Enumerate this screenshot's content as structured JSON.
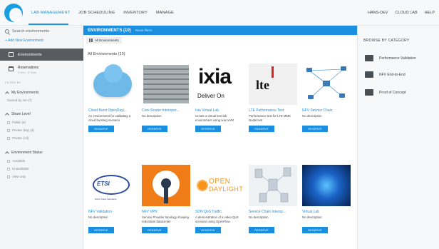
{
  "topnav": {
    "items": [
      {
        "label": "LAB MANAGEMENT",
        "active": true
      },
      {
        "label": "JOB SCHEDULING",
        "active": false
      },
      {
        "label": "INVENTORY",
        "active": false
      },
      {
        "label": "MANAGE",
        "active": false
      }
    ],
    "right": [
      "HANS-DEV",
      "CLOUD LAB",
      "HELP"
    ]
  },
  "sidebar": {
    "search_placeholder": "Search environments",
    "add_environment": "+ Add New Environment",
    "environments_label": "Environments",
    "reservations_label": "Reservations",
    "reservations_sub": "3 Nex · 5 Total",
    "filter_by": "FILTER BY",
    "my_envs": {
      "title": "My Environments",
      "options": [
        "Owned by me (7)"
      ]
    },
    "share_level": {
      "title": "Share Level",
      "options": [
        "Public (6)",
        "Private (My) (4)",
        "Private (All)"
      ]
    },
    "env_status": {
      "title": "Environment Status",
      "options": [
        "Available",
        "Unavailable",
        "View only"
      ]
    }
  },
  "header": {
    "title": "ENVIRONMENTS (10)",
    "reset": "Reset filters",
    "toggle_label": "All Environments",
    "section_heading": "All Environments (10)"
  },
  "right_panel": {
    "title": "BROWSE BY CATEGORY",
    "categories": [
      "Performance Validation",
      "NFV End-to-End",
      "Proof of Concept"
    ]
  },
  "reserve_label": "RESERVE",
  "cards": [
    {
      "name": "Cloud Burst OpenDayl...",
      "desc": "An environment for validating a cloud bursting scenario",
      "thumb": "cloud"
    },
    {
      "name": "Core Router Interoper...",
      "desc": "No description",
      "thumb": "router"
    },
    {
      "name": "Ixia Virtual Lab",
      "desc": "Create a virtual test lab environment using Ixia IxVM",
      "thumb": "ixia"
    },
    {
      "name": "LTE Performance Test",
      "desc": "Performance test for LTE MME Nodal test",
      "thumb": "lte"
    },
    {
      "name": "NFV Service Chain",
      "desc": "No description",
      "thumb": "network"
    },
    {
      "name": "NFV Validation",
      "desc": "No description",
      "thumb": "etsi"
    },
    {
      "name": "NFV VPN",
      "desc": "Service Provider topology showing redundant datacenter",
      "thumb": "vpn"
    },
    {
      "name": "SDN QoS Traffic",
      "desc": "A demonstration of a video QoS scenario using OpenFlow",
      "thumb": "odl"
    },
    {
      "name": "Service Chain Interop...",
      "desc": "No description",
      "thumb": "chain"
    },
    {
      "name": "Virtual Lab",
      "desc": "No description",
      "thumb": "virtual"
    }
  ],
  "thumb_text": {
    "ixia_big": "ixia",
    "ixia_small": "Deliver On",
    "lte": "lte",
    "etsi": "ETSI",
    "etsi_sub": "World Class Standards",
    "odl_1": "OPEN",
    "odl_2": "DAYLIGHT"
  }
}
